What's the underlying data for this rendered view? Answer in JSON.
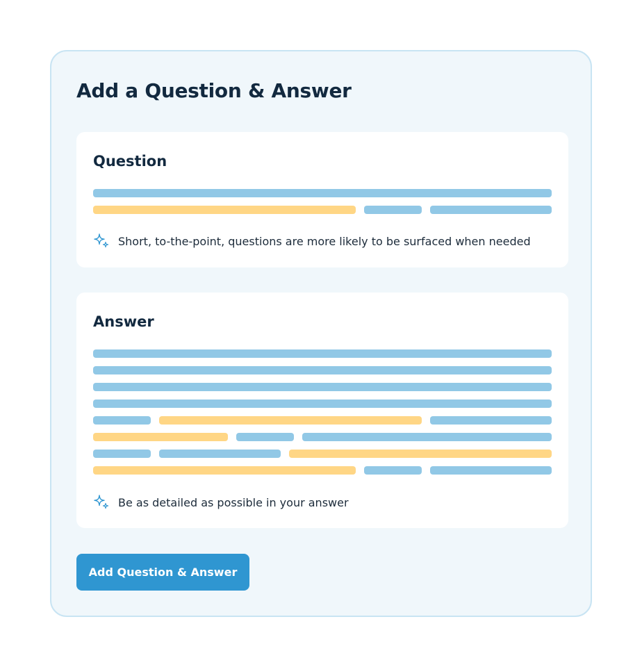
{
  "form": {
    "title": "Add a Question & Answer",
    "question": {
      "label": "Question",
      "hint_icon": "sparkle-icon",
      "hint": "Short, to-the-point, questions are more likely to be surfaced when needed"
    },
    "answer": {
      "label": "Answer",
      "hint_icon": "sparkle-icon",
      "hint": "Be as detailed as possible in your answer"
    },
    "submit_label": "Add Question & Answer"
  },
  "colors": {
    "panel_bg": "#f0f7fb",
    "panel_border": "#c8e4f3",
    "placeholder_blue": "#91c8e6",
    "placeholder_yellow": "#ffd685",
    "button": "#2f96d1",
    "heading": "#12293f"
  }
}
